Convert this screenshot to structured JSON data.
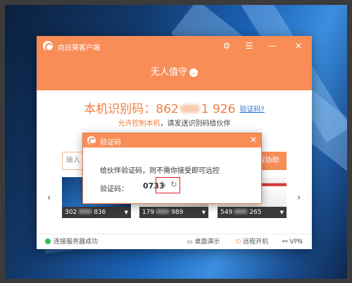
{
  "app": {
    "title": "向日葵客户端",
    "status_title": "无人值守",
    "id_label": "本机识别码：",
    "id_prefix": "862",
    "id_suffix": "1 926",
    "id_help": "验证码?",
    "allow_link": "允许控制本机",
    "allow_text": "，请发送识别码给伙伴",
    "partner_input_placeholder": "输入",
    "assist_button": "远程协助",
    "thumbnails": [
      {
        "prefix": "302",
        "suffix": "836"
      },
      {
        "prefix": "179",
        "suffix": "989"
      },
      {
        "prefix": "549",
        "suffix": "265"
      }
    ],
    "footer": {
      "connection": "连接服务器成功",
      "desktop_demo": "桌面演示",
      "remote_boot": "远程开机",
      "vpn": "VPN"
    },
    "colors": {
      "accent": "#f98d57",
      "id_color": "#f07e3f",
      "status_ok": "#2fc24a"
    }
  },
  "dialog": {
    "title": "验证码",
    "message": "给伙伴验证码，则不需你接受即可远控",
    "code_label": "验证码：",
    "code_value": "0733",
    "edit_icon": "edit-icon",
    "refresh_icon": "refresh-icon"
  }
}
